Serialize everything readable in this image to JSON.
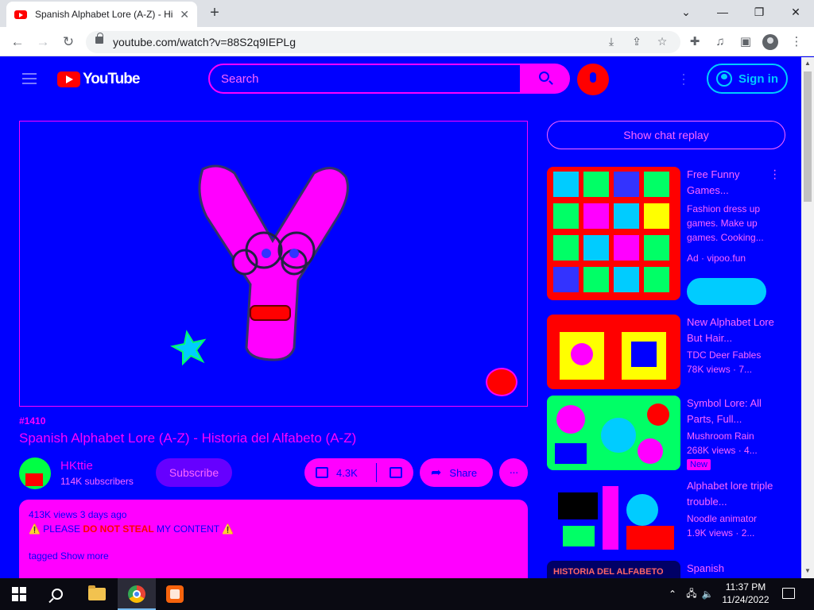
{
  "browser": {
    "tab_title": "Spanish Alphabet Lore (A-Z) - Hi",
    "url": "youtube.com/watch?v=88S2q9IEPLg"
  },
  "youtube": {
    "logo_text": "YouTube",
    "search_placeholder": "Search",
    "sign_in": "Sign in"
  },
  "video": {
    "hashtag": "#1410",
    "title": "Spanish Alphabet Lore (A-Z) - Historia del Alfabeto (A-Z)",
    "channel_name": "HKttie",
    "subscribers": "114K subscribers",
    "subscribe_label": "Subscribe",
    "likes": "4.3K",
    "share_label": "Share",
    "more_label": "···",
    "description": {
      "meta": "413K views  3 days ago",
      "line1_prefix": "⚠️ PLEASE ",
      "line1_red": "DO NOT STEAL",
      "line1_suffix": " MY CONTENT ⚠️",
      "tags": "tagged  Show more"
    }
  },
  "sidebar": {
    "chat_replay": "Show chat replay",
    "recommendations": [
      {
        "title": "Free Funny Games...",
        "line2": "Fashion dress up games. Make up games. Cooking...",
        "line3": "Ad · vipoo.fun"
      },
      {
        "title": "New Alphabet Lore But Hair...",
        "line2": "TDC Deer Fables",
        "line3": "78K views · 7..."
      },
      {
        "title": "Symbol Lore: All Parts, Full...",
        "line2": "Mushroom Rain",
        "line3": "268K views · 4...",
        "badge": "New"
      },
      {
        "title": "Alphabet lore triple trouble...",
        "line2": "Noodle animator",
        "line3": "1.9K views · 2..."
      },
      {
        "title": "Spanish",
        "thumb_text": "HISTORIA DEL ALFABETO"
      }
    ]
  },
  "taskbar": {
    "time": "11:37 PM",
    "date": "11/24/2022"
  }
}
